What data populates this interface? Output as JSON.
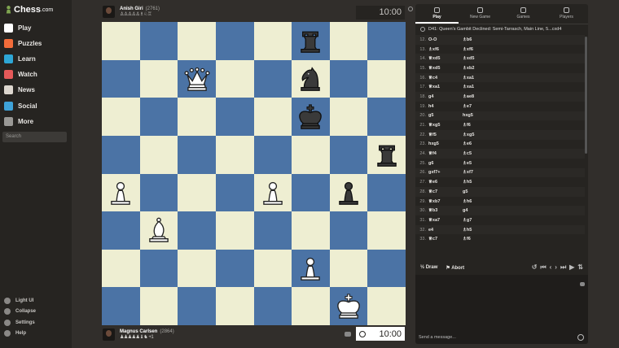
{
  "brand": {
    "name": "Chess",
    "domain": ".com"
  },
  "nav": [
    {
      "label": "Play",
      "color": "#ffffff",
      "icon": "play-icon"
    },
    {
      "label": "Puzzles",
      "color": "#f26c3a",
      "icon": "puzzle-icon"
    },
    {
      "label": "Learn",
      "color": "#2ea7d6",
      "icon": "learn-icon"
    },
    {
      "label": "Watch",
      "color": "#e55959",
      "icon": "watch-icon"
    },
    {
      "label": "News",
      "color": "#ddd7cf",
      "icon": "news-icon"
    },
    {
      "label": "Social",
      "color": "#3fa3d9",
      "icon": "social-icon"
    },
    {
      "label": "More",
      "color": "#9a9996",
      "icon": "more-icon"
    }
  ],
  "search": {
    "placeholder": "Search"
  },
  "footer": [
    {
      "label": "Light UI",
      "icon": "light-ui-icon"
    },
    {
      "label": "Collapse",
      "icon": "collapse-icon"
    },
    {
      "label": "Settings",
      "icon": "settings-icon"
    },
    {
      "label": "Help",
      "icon": "help-icon"
    }
  ],
  "top_player": {
    "name": "Anish Giri",
    "rating": "(2761)",
    "captured": "♙♙♙♙♙♗♘♖",
    "clock": "10:00"
  },
  "bottom_player": {
    "name": "Magnus Carlsen",
    "rating": "(2864)",
    "captured": "♟♟♟♟♟♝♞",
    "advantage": "+1",
    "clock": "10:00"
  },
  "board": [
    [
      "",
      "",
      "",
      "",
      "",
      "bR",
      "",
      ""
    ],
    [
      "",
      "",
      "wQ",
      "",
      "",
      "bN",
      "",
      ""
    ],
    [
      "",
      "",
      "",
      "",
      "",
      "bK",
      "",
      ""
    ],
    [
      "",
      "",
      "",
      "",
      "",
      "",
      "",
      "bR"
    ],
    [
      "wP",
      "",
      "",
      "",
      "wP",
      "",
      "bP",
      ""
    ],
    [
      "",
      "wB",
      "",
      "",
      "",
      "",
      "",
      ""
    ],
    [
      "",
      "",
      "",
      "",
      "",
      "wP",
      "",
      ""
    ],
    [
      "",
      "",
      "",
      "",
      "",
      "",
      "wK",
      ""
    ]
  ],
  "tabs": [
    {
      "label": "Play",
      "icon": "play-tab-icon",
      "active": true
    },
    {
      "label": "New Game",
      "icon": "new-game-icon",
      "active": false
    },
    {
      "label": "Games",
      "icon": "games-icon",
      "active": false
    },
    {
      "label": "Players",
      "icon": "players-icon",
      "active": false
    }
  ],
  "opening": "D41: Queen's Gambit Declined: Semi-Tarrasch, Main Line, 5...cxd4",
  "moves": [
    {
      "n": "12.",
      "w": "O-O",
      "b": "♗b6"
    },
    {
      "n": "13.",
      "w": "♗xf6",
      "b": "♗xf6"
    },
    {
      "n": "14.",
      "w": "♕xd5",
      "b": "♗xd5"
    },
    {
      "n": "15.",
      "w": "♕xd5",
      "b": "♗xb2"
    },
    {
      "n": "16.",
      "w": "♕c4",
      "b": "♗xa1"
    },
    {
      "n": "17.",
      "w": "♕xa1",
      "b": "♗xa1"
    },
    {
      "n": "18.",
      "w": "g4",
      "b": "♗ae8"
    },
    {
      "n": "19.",
      "w": "h4",
      "b": "♗e7"
    },
    {
      "n": "20.",
      "w": "g5",
      "b": "hxg5"
    },
    {
      "n": "21.",
      "w": "♕xg5",
      "b": "♗f6"
    },
    {
      "n": "22.",
      "w": "♕f5",
      "b": "♗xg5"
    },
    {
      "n": "23.",
      "w": "hxg5",
      "b": "♗e6"
    },
    {
      "n": "24.",
      "w": "♕f4",
      "b": "♗c5"
    },
    {
      "n": "25.",
      "w": "g6",
      "b": "♗e5"
    },
    {
      "n": "26.",
      "w": "gxf7+",
      "b": "♗xf7"
    },
    {
      "n": "27.",
      "w": "♕e6",
      "b": "♗h5"
    },
    {
      "n": "28.",
      "w": "♕c7",
      "b": "g5"
    },
    {
      "n": "29.",
      "w": "♕xb7",
      "b": "♗h6"
    },
    {
      "n": "30.",
      "w": "♕b3",
      "b": "g4"
    },
    {
      "n": "31.",
      "w": "♕xa7",
      "b": "♗g7"
    },
    {
      "n": "32.",
      "w": "e4",
      "b": "♗h5"
    },
    {
      "n": "33.",
      "w": "♕c7",
      "b": "♗f6"
    }
  ],
  "controls": {
    "draw": "Draw",
    "draw_prefix": "½",
    "abort": "Abort"
  },
  "chat": {
    "placeholder": "Send a message..."
  },
  "colors": {
    "light_square": "#eeeed2",
    "dark_square": "#4b73a5",
    "background": "#312e2b"
  }
}
